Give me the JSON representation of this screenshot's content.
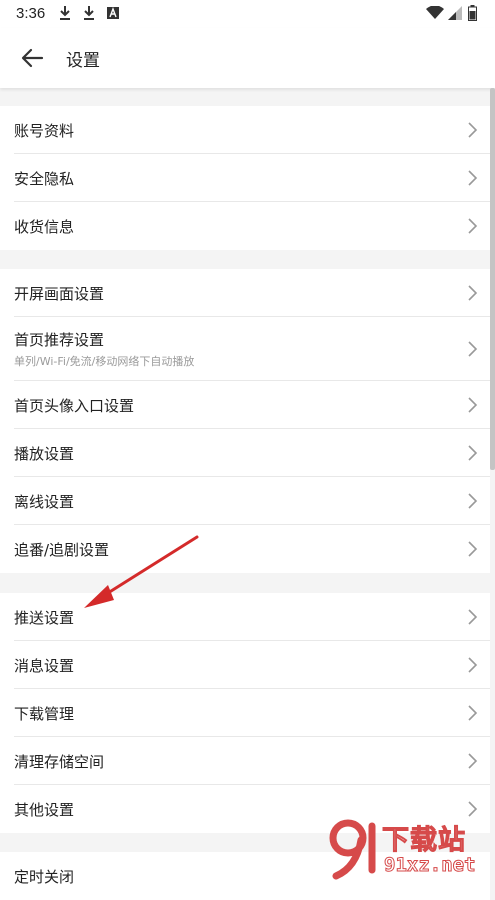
{
  "status_bar": {
    "time": "3:36"
  },
  "header": {
    "title": "设置"
  },
  "groups": [
    {
      "items": [
        {
          "label": "账号资料"
        },
        {
          "label": "安全隐私"
        },
        {
          "label": "收货信息"
        }
      ]
    },
    {
      "items": [
        {
          "label": "开屏画面设置"
        },
        {
          "label": "首页推荐设置",
          "subtitle": "单列/Wi-Fi/免流/移动网络下自动播放"
        },
        {
          "label": "首页头像入口设置"
        },
        {
          "label": "播放设置"
        },
        {
          "label": "离线设置"
        },
        {
          "label": "追番/追剧设置"
        }
      ]
    },
    {
      "items": [
        {
          "label": "推送设置"
        },
        {
          "label": "消息设置"
        },
        {
          "label": "下载管理"
        },
        {
          "label": "清理存储空间"
        },
        {
          "label": "其他设置"
        }
      ]
    },
    {
      "items": [
        {
          "label": "定时关闭"
        }
      ]
    }
  ],
  "watermark": {
    "text": "下载站",
    "url": "91xz.net"
  },
  "colors": {
    "annotation_arrow": "#d42a2a",
    "watermark": "#d64a4a"
  }
}
